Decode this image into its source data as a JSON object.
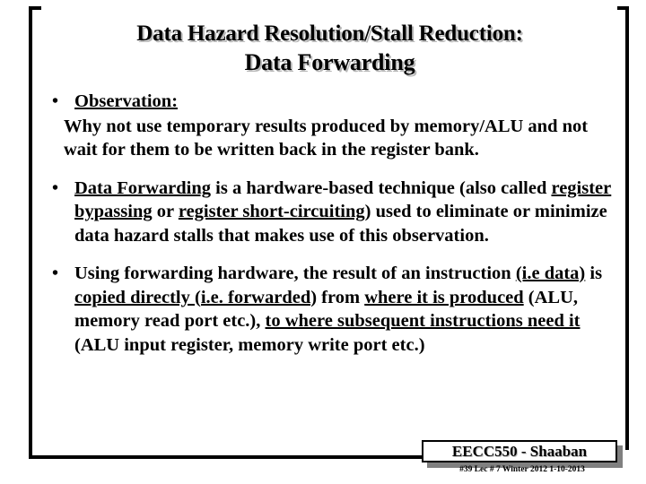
{
  "slide": {
    "title": {
      "line1": "Data Hazard Resolution/Stall Reduction:",
      "line2": "Data Forwarding"
    },
    "bullets": [
      {
        "id": "observation",
        "marker": "•",
        "lead_underlined": "Observation:",
        "body": "Why not use temporary results produced by memory/ALU and not wait for them to be written back in the register bank."
      },
      {
        "id": "data-forwarding-definition",
        "marker": "•",
        "seg1_underlined": "Data Forwarding",
        "seg2": " is a hardware-based technique (also called ",
        "seg3_underlined": "register bypassing",
        "seg4": " or ",
        "seg5_underlined": "register short-circuiting",
        "seg6": ") used to eliminate or minimize data hazard stalls that makes use of this observation."
      },
      {
        "id": "forwarding-hardware",
        "marker": "•",
        "seg1": "Using forwarding hardware, the result of an instruction ",
        "seg2_underlined": "(i.e data)",
        "seg3": " is ",
        "seg4_underlined": "copied directly (i.e. forwarded)",
        "seg5": " from ",
        "seg6_underlined": "where it is produced",
        "seg7": "  (ALU, memory read port etc.),  ",
        "seg8_underlined": "to where subsequent instructions need it",
        "seg9": " (ALU input register, memory write port etc.)"
      }
    ],
    "footer": {
      "course_tag": "EECC550 - Shaaban",
      "meta": "#39   Lec # 7  Winter 2012  1-10-2013"
    }
  },
  "colors": {
    "text": "#000000",
    "background": "#ffffff",
    "frame": "#000000",
    "shadow_gray": "#808080",
    "title_shadow": "#b8b8b8"
  }
}
